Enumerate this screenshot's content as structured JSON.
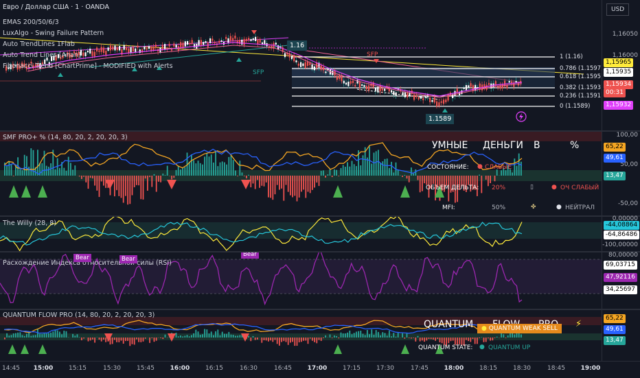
{
  "symbol": "Евро / Доллар США · 1 · OANDA",
  "currency_button": "USD",
  "main_indicators": [
    "EMAS 200/50/6/3",
    "LuxAlgo - Swing Failure Pattern",
    "Auto TrendLines 1Flab",
    "Auto Trend Lines [Anan]",
    "Fibonacci Trend [ChartPrime] - MODIFIED with Alerts"
  ],
  "main_scale": {
    "ticks": [
      "1,16050",
      "1,16000"
    ],
    "tags": [
      "1,15965",
      "1,15935",
      "1,15934",
      "00:31",
      "1,15932"
    ]
  },
  "chart_labels": {
    "high_label": "1.16",
    "low_label": "1.1589",
    "sfp_low": "SFP",
    "sfp_high": "SFP"
  },
  "fib_levels": [
    "1 (1.16)",
    "0.786 (1.1597)",
    "0.618 (1.1595)",
    "0.382 (1.1593)",
    "0.236 (1.1591)",
    "0 (1.1589)"
  ],
  "smf": {
    "title": "SMF PRO+ % (14, 80, 20, 2, 20, 20, 3)",
    "ticks": [
      "100,00",
      "50,00",
      "-50,00"
    ],
    "tags": [
      "65,22",
      "49,61",
      "13,47"
    ],
    "table": {
      "h1": "УМНЫЕ",
      "h2": "ДЕНЬГИ",
      "h3": "В",
      "h4": "%",
      "r1_label": "СОСТОЯНИЕ:",
      "r1_value": "СЛАБЫЕ",
      "r2_label": "ОБЪЕМ ДЕЛЬТА:",
      "r2_pct": "20%",
      "r2_value": "ОЧ СЛАБЫЙ",
      "r3_label": "MFI:",
      "r3_pct": "50%",
      "r3_value": "НЕЙТРАЛ"
    }
  },
  "willy": {
    "title": "The Willy (28, 8)",
    "ticks": [
      "0,00000",
      "-100,00000"
    ],
    "tags": [
      "-44,08864",
      "-64,86486"
    ]
  },
  "rsi": {
    "title": "Расхождение Индекса относительной силы (RSI)",
    "ticks": [
      "80,00000"
    ],
    "tags": [
      "69,03715",
      "47,92116",
      "34,25697"
    ],
    "bear_label": "Bear"
  },
  "qflow": {
    "title": "QUANTUM FLOW PRO (14, 80, 20, 2, 20, 20, 3)",
    "tags": [
      "65,22",
      "49,61",
      "13,47"
    ],
    "h1": "QUANTUM",
    "h2": "FLOW",
    "h3": "PRO",
    "signal": "QUANTUM WEAK SELL",
    "state_label": "QUANTUM STATE:",
    "state_value": "QUANTUM UP"
  },
  "time_axis": [
    "14:45",
    "15:00",
    "15:15",
    "15:30",
    "15:45",
    "16:00",
    "16:15",
    "16:30",
    "16:45",
    "17:00",
    "17:15",
    "17:30",
    "17:45",
    "18:00",
    "18:15",
    "18:30",
    "18:45",
    "19:00"
  ],
  "colors": {
    "bull": "#26a69a",
    "bear": "#ef5350",
    "orange": "#f5a623",
    "blue": "#2962ff",
    "purple": "#9c27b0",
    "yellow": "#ffeb3b",
    "magenta": "#e040fb"
  }
}
